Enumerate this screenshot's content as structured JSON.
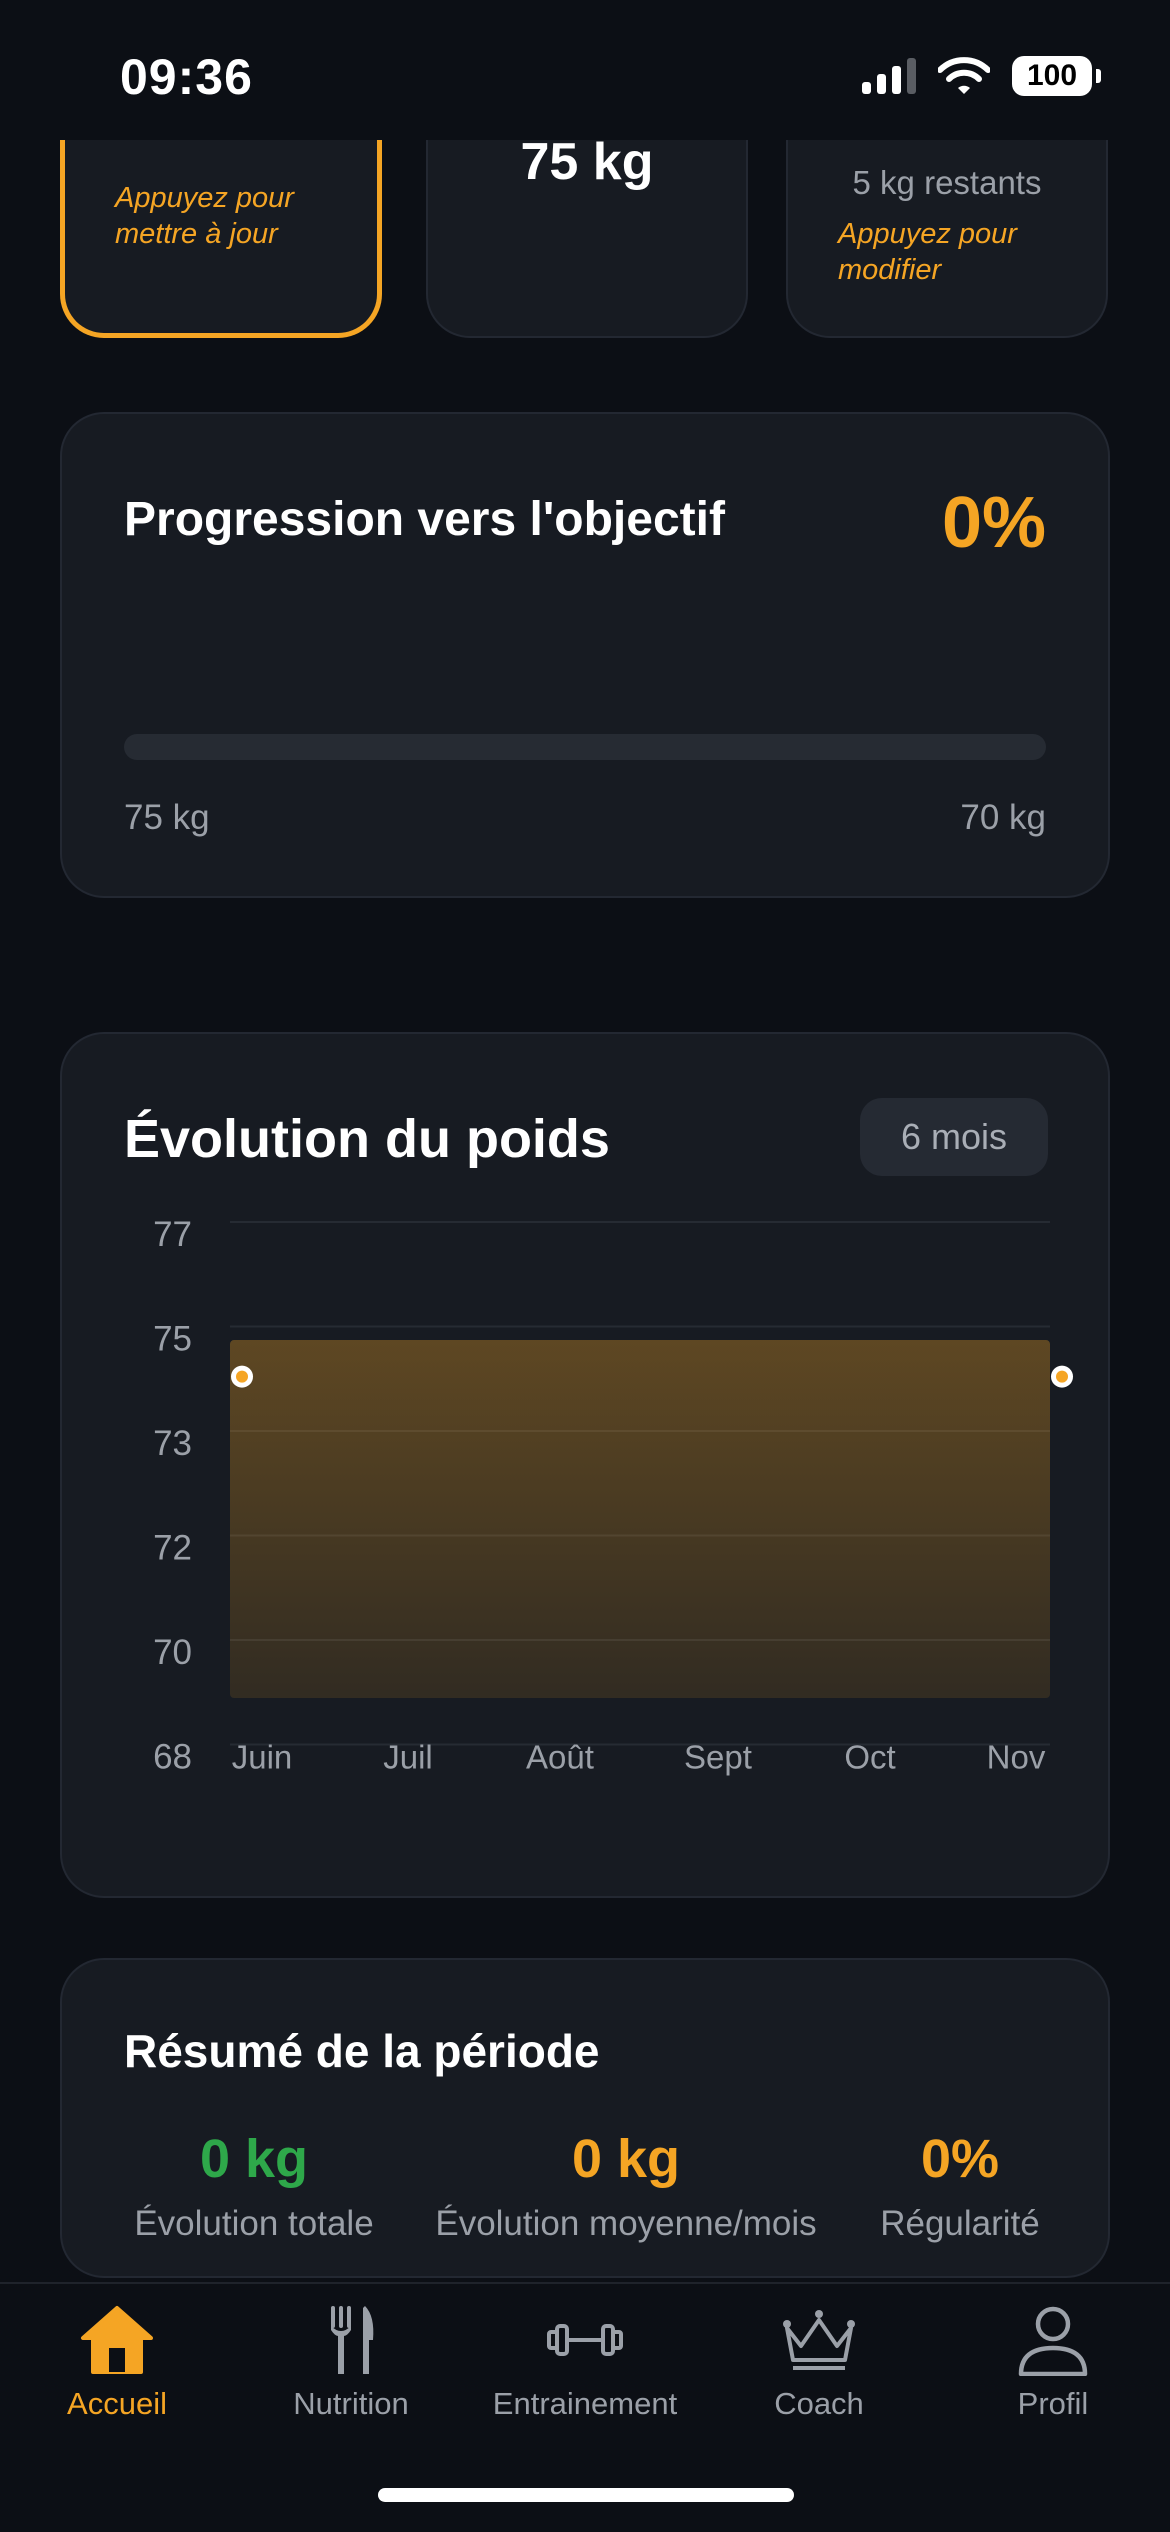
{
  "status_bar": {
    "time": "09:36",
    "battery": "100"
  },
  "top_cards": {
    "current": {
      "hint": "Appuyez pour mettre à jour"
    },
    "start": {
      "value": "75 kg"
    },
    "goal": {
      "remaining": "5 kg restants",
      "hint": "Appuyez pour modifier"
    }
  },
  "progress": {
    "title": "Progression vers l'objectif",
    "percent_label": "0%",
    "percent": 0,
    "start_label": "75 kg",
    "end_label": "70 kg"
  },
  "weight_chart": {
    "title": "Évolution du poids",
    "period": "6 mois"
  },
  "chart_data": {
    "type": "area",
    "title": "Évolution du poids",
    "xlabel": "",
    "ylabel": "",
    "x_ticks": [
      "Juin",
      "Juil",
      "Août",
      "Sept",
      "Oct",
      "Nov"
    ],
    "y_ticks": [
      77,
      75,
      73,
      72,
      70,
      68
    ],
    "ylim": [
      68,
      77
    ],
    "series": [
      {
        "points": [
          {
            "x": "Juin",
            "y": 74.5
          },
          {
            "x": "Nov",
            "y": 74.5
          }
        ]
      }
    ],
    "grid": true,
    "accent_color": "#f5a524"
  },
  "summary": {
    "title": "Résumé de la période",
    "stats": [
      {
        "value": "0 kg",
        "label": "Évolution totale",
        "color": "#2ea84a"
      },
      {
        "value": "0 kg",
        "label": "Évolution moyenne/mois",
        "color": "#f5a524"
      },
      {
        "value": "0%",
        "label": "Régularité",
        "color": "#f5a524"
      }
    ]
  },
  "tab_bar": {
    "tabs": [
      {
        "label": "Accueil",
        "icon": "home-icon",
        "active": true
      },
      {
        "label": "Nutrition",
        "icon": "fork-knife-icon",
        "active": false
      },
      {
        "label": "Entrainement",
        "icon": "dumbbell-icon",
        "active": false
      },
      {
        "label": "Coach",
        "icon": "crown-icon",
        "active": false
      },
      {
        "label": "Profil",
        "icon": "person-icon",
        "active": false
      }
    ]
  },
  "colors": {
    "accent": "#f5a524",
    "positive": "#2ea84a",
    "background": "#0c0f15",
    "card": "#171b22"
  }
}
